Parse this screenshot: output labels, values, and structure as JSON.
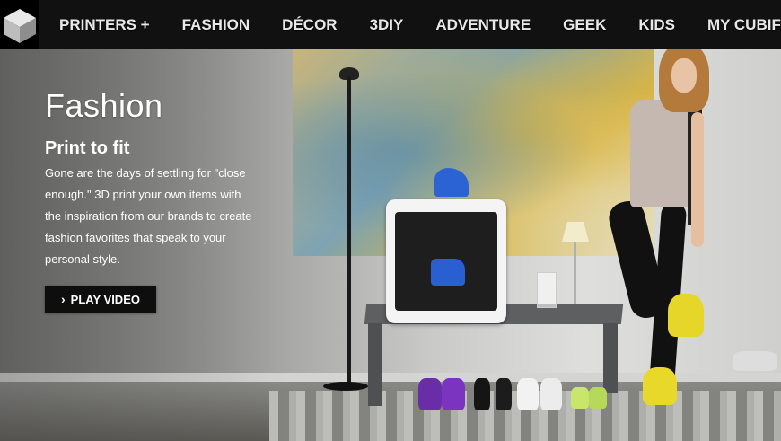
{
  "nav": {
    "logo_icon": "cube-logo-icon",
    "items": [
      {
        "label": "PRINTERS +"
      },
      {
        "label": "FASHION"
      },
      {
        "label": "DÉCOR"
      },
      {
        "label": "3DIY"
      },
      {
        "label": "ADVENTURE"
      },
      {
        "label": "GEEK"
      },
      {
        "label": "KIDS"
      },
      {
        "label": "MY CUBIFY"
      }
    ]
  },
  "hero": {
    "title": "Fashion",
    "subtitle": "Print to fit",
    "body": "Gone are the days of settling for \"close enough.\" 3D print your own items with the inspiration from our brands to create fashion favorites that speak to your personal style.",
    "cta_label": "PLAY VIDEO",
    "cta_icon": "chevron-right-icon"
  }
}
